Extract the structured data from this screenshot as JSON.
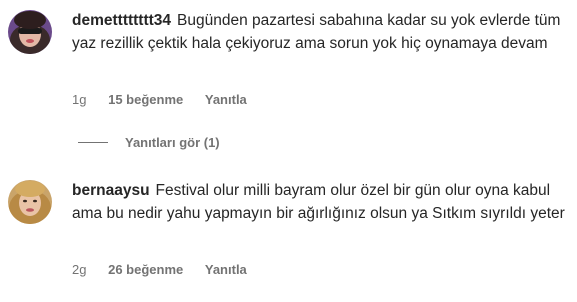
{
  "comments": [
    {
      "username": "demetttttttt34",
      "text": "Bugünden pazartesi sabahına kadar su yok evlerde tüm yaz rezillik çektik hala çekiyoruz ama sorun yok hiç oynamaya devam",
      "time": "1g",
      "likes": "15 beğenme",
      "reply_label": "Yanıtla"
    },
    {
      "username": "bernaaysu",
      "text": "Festival olur milli bayram olur özel bir gün olur oyna kabul ama bu nedir yahu yapmayın bir ağırlığınız olsun ya Sıtkım sıyrıldı yeter",
      "time": "2g",
      "likes": "26 beğenme",
      "reply_label": "Yanıtla"
    }
  ],
  "view_replies": "Yanıtları gör (1)"
}
